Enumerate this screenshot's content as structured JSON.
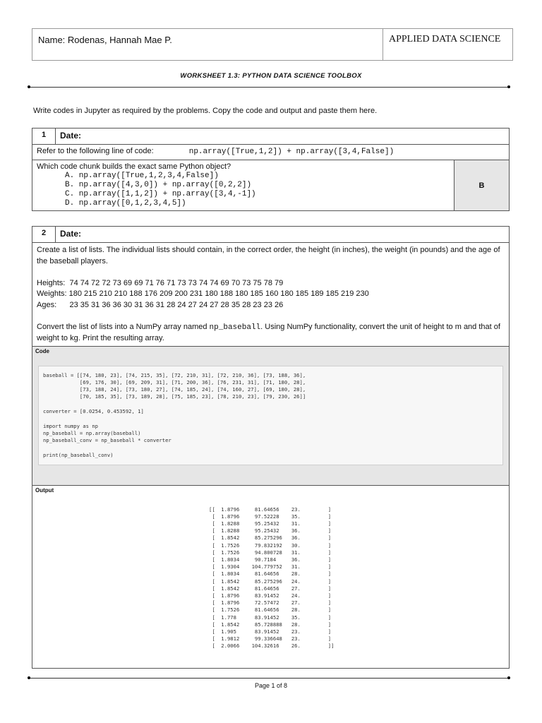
{
  "header": {
    "name": "Name: Rodenas, Hannah Mae P.",
    "subject": "APPLIED DATA SCIENCE"
  },
  "title": "WORKSHEET 1.3: PYTHON DATA SCIENCE TOOLBOX",
  "intro": "Write codes in Jupyter as required by the problems. Copy the code and output and paste them here.",
  "q1": {
    "number": "1",
    "date_label": "Date:",
    "refer": "Refer to the following line of code:",
    "code": "np.array([True,1,2]) + np.array([3,4,False])",
    "question": "Which code chunk builds the exact same Python object?",
    "options": [
      "A. np.array([True,1,2,3,4,False])",
      "B. np.array([4,3,0]) + np.array([0,2,2])",
      "C. np.array([1,1,2]) + np.array([3,4,-1])",
      "D. np.array([0,1,2,3,4,5])"
    ],
    "answer": "B"
  },
  "q2": {
    "number": "2",
    "date_label": "Date:",
    "desc": "Create a list of lists. The individual lists should contain, in the correct order, the height (in inches), the weight (in pounds) and the age of the baseball players.",
    "heights": "Heights:  74 74 72 72 73 69 69 71 76 71 73 73 74 74 69 70 73 75 78 79",
    "weights": "Weights: 180 215 210 210 188 176 209 200 231 180 188 180 185 160 180 185 189 185 219 230",
    "ages": "Ages:      23 35 31 36 36 30 31 36 31 28 24 27 24 27 28 35 28 23 23 26",
    "convert_pre": "Convert the list of lists into a NumPy array named ",
    "convert_code": "np_baseball",
    "convert_post": ". Using NumPy functionality, convert the unit of height to m and that of weight to kg. Print the resulting array.",
    "code_label": "Code",
    "code": "baseball = [[74, 180, 23], [74, 215, 35], [72, 210, 31], [72, 210, 36], [73, 188, 36],\n            [69, 176, 30], [69, 209, 31], [71, 200, 36], [76, 231, 31], [71, 180, 28],\n            [73, 188, 24], [73, 180, 27], [74, 185, 24], [74, 160, 27], [69, 180, 28],\n            [70, 185, 35], [73, 189, 28], [75, 185, 23], [78, 210, 23], [79, 230, 26]]\n\nconverter = [0.0254, 0.453592, 1]\n\nimport numpy as np\nnp_baseball = np.array(baseball)\nnp_baseball_conv = np_baseball * converter\n\nprint(np_baseball_conv)",
    "output_label": "Output",
    "output": "[[  1.8796     81.64656    23.         ]\n [  1.8796     97.52228    35.         ]\n [  1.8288     95.25432    31.         ]\n [  1.8288     95.25432    36.         ]\n [  1.8542     85.275296   36.         ]\n [  1.7526     79.832192   30.         ]\n [  1.7526     94.800728   31.         ]\n [  1.8034     90.7184     36.         ]\n [  1.9304    104.779752   31.         ]\n [  1.8034     81.64656    28.         ]\n [  1.8542     85.275296   24.         ]\n [  1.8542     81.64656    27.         ]\n [  1.8796     83.91452    24.         ]\n [  1.8796     72.57472    27.         ]\n [  1.7526     81.64656    28.         ]\n [  1.778      83.91452    35.         ]\n [  1.8542     85.728888   28.         ]\n [  1.905      83.91452    23.         ]\n [  1.9812     99.336648   23.         ]\n [  2.0066    104.32616    26.         ]]"
  },
  "footer": "Page 1 of 8"
}
